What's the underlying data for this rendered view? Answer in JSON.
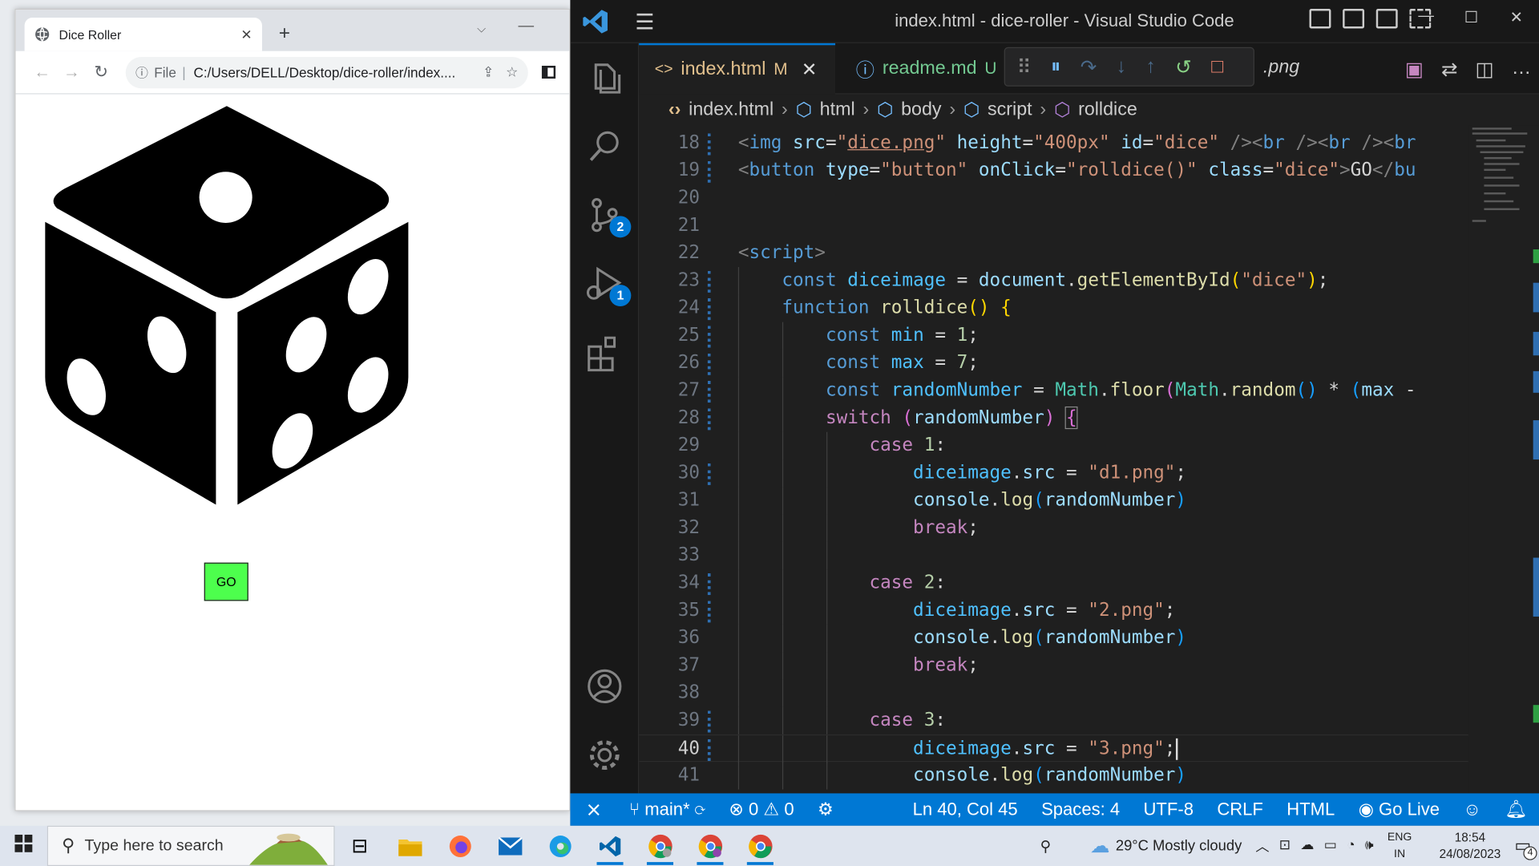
{
  "browser": {
    "tab_title": "Dice Roller",
    "tab_close": "✕",
    "new_tab": "+",
    "minimize": "—",
    "tab_menu": "⌵",
    "back": "←",
    "forward": "→",
    "reload": "↻",
    "url_prefix": "File",
    "url_sep": "|",
    "url": "C:/Users/DELL/Desktop/dice-roller/index....",
    "share_icon": "⇪",
    "star_icon": "☆",
    "page": {
      "go_button": "GO"
    }
  },
  "vscode": {
    "window_title": "index.html - dice-roller - Visual Studio Code",
    "menu_icon": "☰",
    "window_buttons": [
      "—",
      "☐",
      "✕"
    ],
    "tabs": [
      {
        "label": "index.html",
        "status": "M",
        "close": "✕",
        "icon": "<>"
      },
      {
        "label": "readme.md",
        "status": "U",
        "icon": "ⓘ"
      }
    ],
    "partial_tab": ".png",
    "debug_toolbar": [
      "⠿",
      "⏸",
      "↷",
      "↓",
      "↑",
      "↺",
      "□"
    ],
    "tab_actions": [
      "▣",
      "⇄",
      "◫",
      "…"
    ],
    "breadcrumb": [
      "index.html",
      "html",
      "body",
      "script",
      "rolldice"
    ],
    "source_control_badge": "2",
    "debug_badge": "1",
    "code_lines": [
      {
        "n": "18"
      },
      {
        "n": "19"
      },
      {
        "n": "20"
      },
      {
        "n": "21"
      },
      {
        "n": "22"
      },
      {
        "n": "23"
      },
      {
        "n": "24"
      },
      {
        "n": "25"
      },
      {
        "n": "26"
      },
      {
        "n": "27"
      },
      {
        "n": "28"
      },
      {
        "n": "29"
      },
      {
        "n": "30"
      },
      {
        "n": "31"
      },
      {
        "n": "32"
      },
      {
        "n": "33"
      },
      {
        "n": "34"
      },
      {
        "n": "35"
      },
      {
        "n": "36"
      },
      {
        "n": "37"
      },
      {
        "n": "38"
      },
      {
        "n": "39"
      },
      {
        "n": "40"
      },
      {
        "n": "41"
      }
    ],
    "status": {
      "remote": "⨯",
      "branch": "main*",
      "sync": "⟳",
      "errors": "0",
      "warnings": "0",
      "cursor": "Ln 40, Col 45",
      "spaces": "Spaces: 4",
      "encoding": "UTF-8",
      "eol": "CRLF",
      "language": "HTML",
      "golive": "Go Live"
    }
  },
  "taskbar": {
    "search_placeholder": "Type here to search",
    "weather": "29°C  Mostly cloudy",
    "lang_top": "ENG",
    "lang_bottom": "IN",
    "time": "18:54",
    "date": "24/08/2023",
    "notifications": "4",
    "task_view_icon": "⊟",
    "people_icon": "⚲",
    "tray_up_icon": "︿",
    "tray_icons": [
      "⊡",
      "☁",
      "▭",
      "◔",
      "🕪"
    ]
  }
}
